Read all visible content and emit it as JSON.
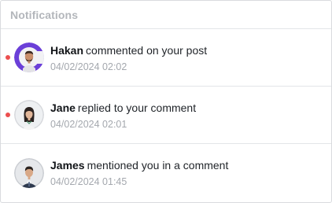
{
  "header": {
    "title": "Notifications"
  },
  "notifications": [
    {
      "actor": "Hakan",
      "action": "commented on your post",
      "timestamp": "04/02/2024 02:02",
      "unread": true,
      "avatar_icon": "avatar-hakan"
    },
    {
      "actor": "Jane",
      "action": "replied to your comment",
      "timestamp": "04/02/2024 02:01",
      "unread": true,
      "avatar_icon": "avatar-jane"
    },
    {
      "actor": "James",
      "action": "mentioned you in a comment",
      "timestamp": "04/02/2024 01:45",
      "unread": false,
      "avatar_icon": "avatar-james"
    }
  ],
  "colors": {
    "unread_dot": "#ec4f4f",
    "accent_ring": "#6b3fd8"
  }
}
